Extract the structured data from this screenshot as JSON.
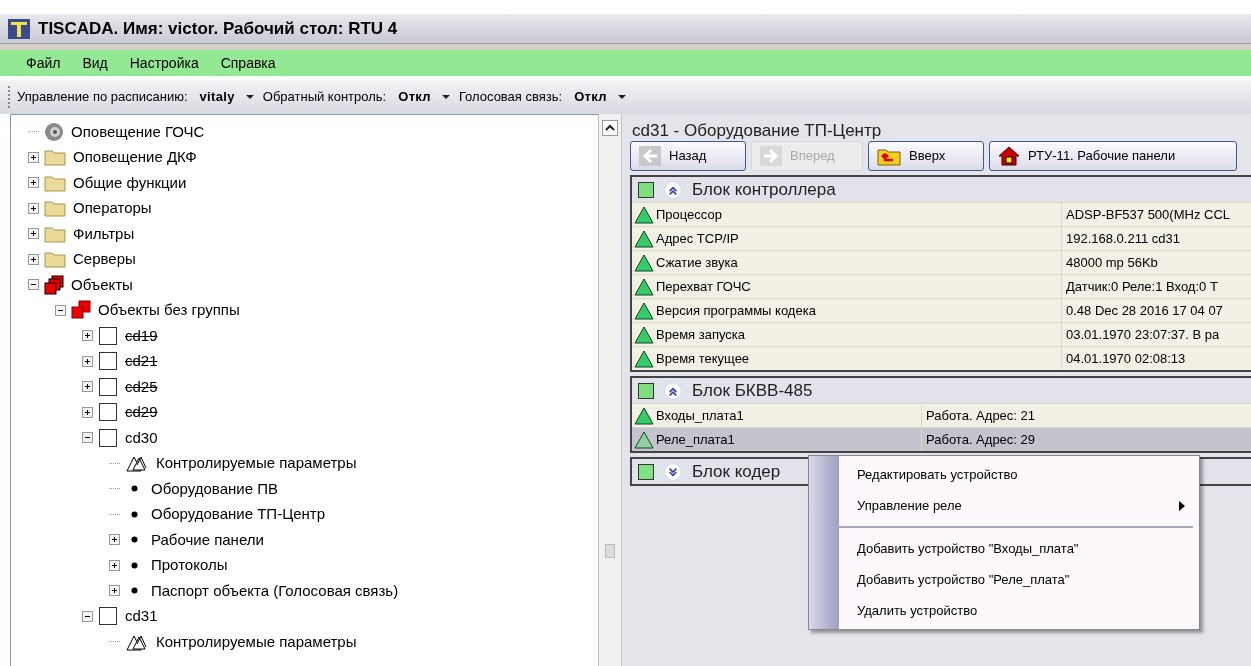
{
  "window": {
    "title": "TISCADA.  Имя: victor.  Рабочий стол: RTU 4"
  },
  "menu": [
    "Файл",
    "Вид",
    "Настройка",
    "Справка"
  ],
  "toolbar": [
    {
      "label": "Управление по расписанию:",
      "value": "vitaly"
    },
    {
      "label": "Обратный контроль:",
      "value": "Откл"
    },
    {
      "label": "Голосовая связь:",
      "value": "Откл"
    }
  ],
  "tree": [
    {
      "label": "Оповещение ГОЧС",
      "kind": "speaker"
    },
    {
      "label": "Оповещение ДКФ",
      "kind": "folder",
      "expanded": false
    },
    {
      "label": "Общие функции",
      "kind": "folder",
      "expanded": false
    },
    {
      "label": "Операторы",
      "kind": "folder",
      "expanded": false
    },
    {
      "label": "Фильтры",
      "kind": "folder",
      "expanded": false
    },
    {
      "label": "Серверы",
      "kind": "folder",
      "expanded": false
    },
    {
      "label": "Объекты",
      "kind": "stack",
      "expanded": true,
      "children": [
        {
          "label": "Объекты без группы",
          "kind": "cube",
          "expanded": true,
          "children": [
            {
              "label": "cd19",
              "kind": "checkbox",
              "expanded": false,
              "struck": true
            },
            {
              "label": "cd21",
              "kind": "checkbox",
              "expanded": false,
              "struck": true
            },
            {
              "label": "cd25",
              "kind": "checkbox",
              "expanded": false,
              "struck": true
            },
            {
              "label": "cd29",
              "kind": "checkbox",
              "expanded": false,
              "struck": true
            },
            {
              "label": "cd30",
              "kind": "checkbox",
              "expanded": true,
              "struck": false,
              "children": [
                {
                  "label": "Контролируемые параметры",
                  "kind": "triangles"
                },
                {
                  "label": "Оборудование ПВ",
                  "kind": "bullet"
                },
                {
                  "label": "Оборудование ТП-Центр",
                  "kind": "bullet"
                },
                {
                  "label": "Рабочие панели",
                  "kind": "bullet",
                  "expanded": false
                },
                {
                  "label": "Протоколы",
                  "kind": "bullet",
                  "expanded": false
                },
                {
                  "label": "Паспорт объекта (Голосовая связь)",
                  "kind": "bullet",
                  "expanded": false
                }
              ]
            },
            {
              "label": "cd31",
              "kind": "checkbox",
              "expanded": true,
              "struck": false,
              "children": [
                {
                  "label": "Контролируемые параметры",
                  "kind": "triangles"
                }
              ]
            }
          ]
        }
      ]
    }
  ],
  "panel": {
    "title": "cd31 - Оборудование ТП-Центр",
    "nav": [
      {
        "label": "Назад",
        "kind": "back",
        "disabled": false
      },
      {
        "label": "Вперед",
        "kind": "forward",
        "disabled": true
      },
      {
        "label": "Вверх",
        "kind": "up",
        "disabled": false
      },
      {
        "label": "РТУ-11. Рабочие панели",
        "kind": "home",
        "disabled": false
      }
    ],
    "sections": [
      {
        "title": "Блок контроллера",
        "expanded": true,
        "rows": [
          {
            "name": "Процессор",
            "value": "ADSP-BF537 500(MHz CCL",
            "selected": false
          },
          {
            "name": "Адрес TCP/IP",
            "value": "192.168.0.211 cd31",
            "selected": false
          },
          {
            "name": "Сжатие звука",
            "value": "48000 mp 56Kb",
            "selected": false
          },
          {
            "name": "Перехват ГОЧС",
            "value": "Датчик:0 Реле:1  Вход:0 Т",
            "selected": false
          },
          {
            "name": "Версия программы кодека",
            "value": "0.48 Dec 28 2016 17 04 07",
            "selected": false
          },
          {
            "name": "Время запуска",
            "value": "03.01.1970  23:07:37.  В ра",
            "selected": false
          },
          {
            "name": "Время текущее",
            "value": "04.01.1970  02:08:13",
            "selected": false
          }
        ]
      },
      {
        "title": "Блок БКВВ-485",
        "expanded": true,
        "rows": [
          {
            "name": "Входы_плата1",
            "value": "Работа.  Адрес: 21",
            "selected": false
          },
          {
            "name": "Реле_плата1",
            "value": "Работа.  Адрес: 29",
            "selected": true
          }
        ]
      },
      {
        "title": "Блок кодер",
        "expanded": false
      }
    ]
  },
  "context_menu": [
    {
      "kind": "item",
      "label": "Редактировать устройство"
    },
    {
      "kind": "submenu",
      "label": "Управление реле"
    },
    {
      "kind": "separator"
    },
    {
      "kind": "item",
      "label": "Добавить устройство \"Входы_плата\""
    },
    {
      "kind": "item",
      "label": "Добавить устройство \"Реле_плата\""
    },
    {
      "kind": "item",
      "label": "Удалить устройство"
    }
  ]
}
